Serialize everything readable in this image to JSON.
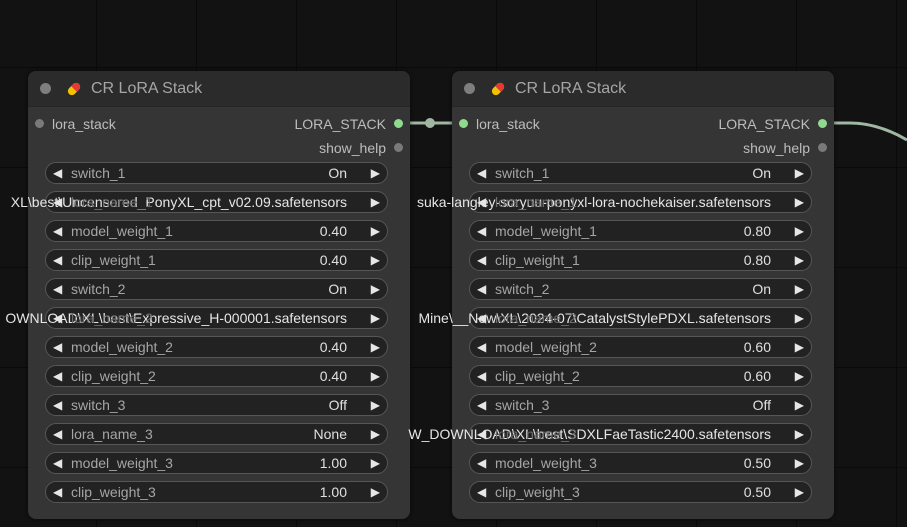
{
  "colors": {
    "background": "#121212",
    "node_body": "#353535",
    "node_header": "#2b2b2b",
    "widget_bg": "#222222",
    "link": "#9fb7a3",
    "connected_slot": "#8fda8f",
    "unconnected_slot": "#7a7a7a"
  },
  "nodes": [
    {
      "title": "CR LoRA Stack",
      "input_label": "lora_stack",
      "output_label": "LORA_STACK",
      "output2_label": "show_help",
      "widgets": [
        {
          "kind": "toggle",
          "label": "switch_1",
          "value": "On"
        },
        {
          "kind": "combo",
          "label": "lora_name_1",
          "value": "XL\\best\\Uncensored_PonyXL_cpt_v02.09.safetensors"
        },
        {
          "kind": "number",
          "label": "model_weight_1",
          "value": "0.40"
        },
        {
          "kind": "number",
          "label": "clip_weight_1",
          "value": "0.40"
        },
        {
          "kind": "toggle",
          "label": "switch_2",
          "value": "On"
        },
        {
          "kind": "combo",
          "label": "lora_name_2",
          "value": "OWNLOAD\\XL\\best\\Expressive_H-000001.safetensors"
        },
        {
          "kind": "number",
          "label": "model_weight_2",
          "value": "0.40"
        },
        {
          "kind": "number",
          "label": "clip_weight_2",
          "value": "0.40"
        },
        {
          "kind": "toggle",
          "label": "switch_3",
          "value": "Off"
        },
        {
          "kind": "combo-plain",
          "label": "lora_name_3",
          "value": "None"
        },
        {
          "kind": "number",
          "label": "model_weight_3",
          "value": "1.00"
        },
        {
          "kind": "number",
          "label": "clip_weight_3",
          "value": "1.00"
        }
      ]
    },
    {
      "title": "CR LoRA Stack",
      "input_label": "lora_stack",
      "output_label": "LORA_STACK",
      "output2_label": "show_help",
      "widgets": [
        {
          "kind": "toggle",
          "label": "switch_1",
          "value": "On"
        },
        {
          "kind": "combo",
          "label": "lora_name_1",
          "value": "suka-langley-soryuu-ponyxl-lora-nochekaiser.safetensors"
        },
        {
          "kind": "number",
          "label": "model_weight_1",
          "value": "0.80"
        },
        {
          "kind": "number",
          "label": "clip_weight_1",
          "value": "0.80"
        },
        {
          "kind": "toggle",
          "label": "switch_2",
          "value": "On"
        },
        {
          "kind": "combo",
          "label": "lora_name_2",
          "value": "Mine\\__New\\XL\\2024-07\\CatalystStylePDXL.safetensors"
        },
        {
          "kind": "number",
          "label": "model_weight_2",
          "value": "0.60"
        },
        {
          "kind": "number",
          "label": "clip_weight_2",
          "value": "0.60"
        },
        {
          "kind": "toggle",
          "label": "switch_3",
          "value": "Off"
        },
        {
          "kind": "combo",
          "label": "lora_name_3",
          "value": "W_DOWNLOAD\\XL\\best\\SDXLFaeTastic2400.safetensors"
        },
        {
          "kind": "number",
          "label": "model_weight_3",
          "value": "0.50"
        },
        {
          "kind": "number",
          "label": "clip_weight_3",
          "value": "0.50"
        }
      ]
    }
  ]
}
